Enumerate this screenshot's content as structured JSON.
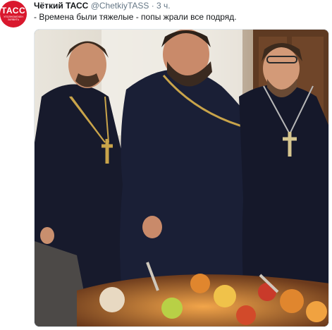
{
  "account": {
    "avatar_logo": "ТАСС",
    "avatar_tagline": "УПОЛНОМОЧЕН ЗАЯВИТЬ",
    "avatar_color": "#d9182d",
    "name": "Чёткий ТАСС",
    "handle": "@ChetkiyTASS",
    "separator": "·",
    "time": "3 ч."
  },
  "tweet": {
    "text": "- Времена были тяжелые - попы жрали все подряд."
  },
  "media": {
    "description_colors": {
      "cassock": "#161a2e",
      "background_wall": "#c9c2b5",
      "window_light": "#eeeae2",
      "door_wood": "#6b3f22",
      "cross_gold": "#c9a44a",
      "food_orange": "#e0862e"
    }
  }
}
